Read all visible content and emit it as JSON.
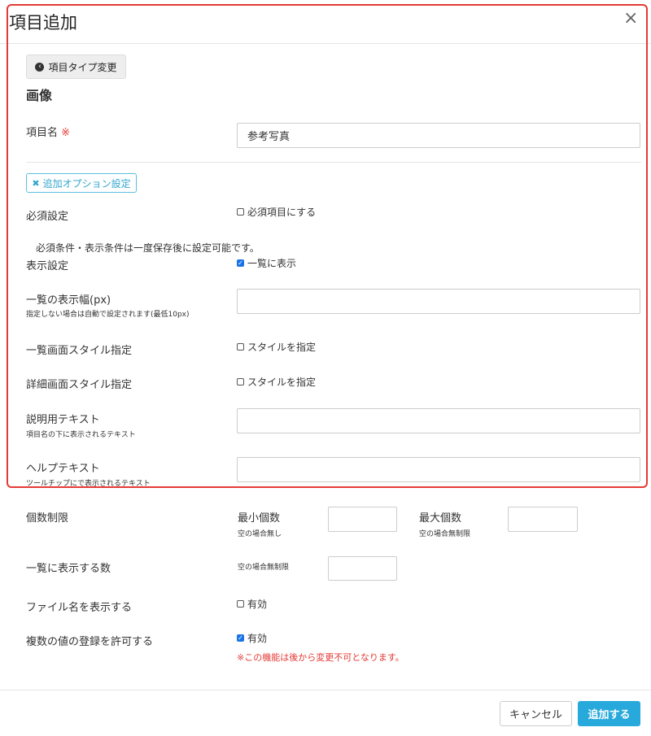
{
  "modal": {
    "title": "項目追加",
    "close_glyph": "×",
    "change_type_label": "項目タイプ変更",
    "section_title": "画像"
  },
  "item_name": {
    "label": "項目名",
    "required_mark": "※",
    "value": "参考写真"
  },
  "options_button": {
    "label": "追加オプション設定"
  },
  "required_setting": {
    "label": "必須設定",
    "checkbox_label": "必須項目にする",
    "checked": false
  },
  "condition_note": "必須条件・表示条件は一度保存後に設定可能です。",
  "display_setting": {
    "label": "表示設定",
    "checkbox_label": "一覧に表示",
    "checked": true
  },
  "list_width": {
    "label": "一覧の表示幅(px)",
    "hint": "指定しない場合は自動で設定されます(最低10px)",
    "value": ""
  },
  "list_style": {
    "label": "一覧画面スタイル指定",
    "checkbox_label": "スタイルを指定",
    "checked": false
  },
  "detail_style": {
    "label": "詳細画面スタイル指定",
    "checkbox_label": "スタイルを指定",
    "checked": false
  },
  "description_text": {
    "label": "説明用テキスト",
    "hint": "項目名の下に表示されるテキスト",
    "value": ""
  },
  "help_text": {
    "label": "ヘルプテキスト",
    "hint": "ツールチップにで表示されるテキスト",
    "value": ""
  },
  "count_limit": {
    "label": "個数制限",
    "min_label": "最小個数",
    "min_hint": "空の場合無し",
    "min_value": "",
    "max_label": "最大個数",
    "max_hint": "空の場合無制限",
    "max_value": ""
  },
  "list_count": {
    "label": "一覧に表示する数",
    "hint": "空の場合無制限",
    "value": ""
  },
  "show_filename": {
    "label": "ファイル名を表示する",
    "checkbox_label": "有効",
    "checked": false
  },
  "allow_multiple": {
    "label": "複数の値の登録を許可する",
    "checkbox_label": "有効",
    "checked": true,
    "warning": "※この機能は後から変更不可となります。"
  },
  "footer": {
    "cancel_label": "キャンセル",
    "submit_label": "追加する"
  },
  "colors": {
    "accent": "#28a9dc",
    "highlight_border": "#e53935",
    "required": "#e53935",
    "option_button": "#5bc0de"
  }
}
